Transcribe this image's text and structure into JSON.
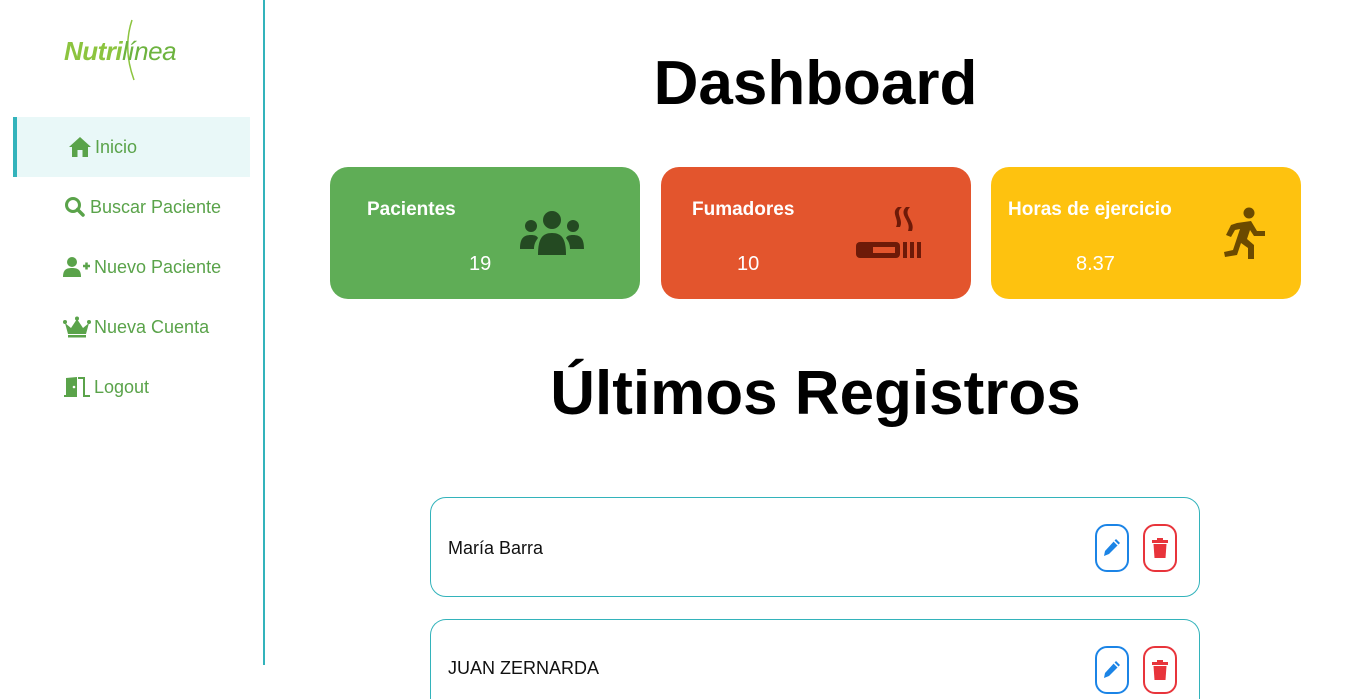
{
  "sidebar": {
    "logo": {
      "part1": "Nutri",
      "part2": "línea"
    },
    "items": [
      {
        "label": "Inicio",
        "icon": "home-icon",
        "active": true
      },
      {
        "label": "Buscar Paciente",
        "icon": "search-icon",
        "active": false
      },
      {
        "label": "Nuevo Paciente",
        "icon": "user-plus-icon",
        "active": false
      },
      {
        "label": "Nueva Cuenta",
        "icon": "crown-icon",
        "active": false
      },
      {
        "label": "Logout",
        "icon": "door-exit-icon",
        "active": false
      }
    ]
  },
  "main": {
    "title": "Dashboard",
    "cards": [
      {
        "label": "Pacientes",
        "value": "19",
        "icon": "users-icon",
        "color": "#5fad56"
      },
      {
        "label": "Fumadores",
        "value": "10",
        "icon": "smoking-icon",
        "color": "#e3552d"
      },
      {
        "label": "Horas de ejercicio",
        "value": "8.37",
        "icon": "running-icon",
        "color": "#fec20f"
      }
    ],
    "records_title": "Últimos Registros",
    "records": [
      {
        "name": "María Barra"
      },
      {
        "name": "JUAN ZERNARDA"
      }
    ]
  },
  "colors": {
    "accent": "#33b3bb",
    "nav_text": "#5aa34a",
    "edit": "#1b84e6",
    "delete": "#e8343b"
  }
}
